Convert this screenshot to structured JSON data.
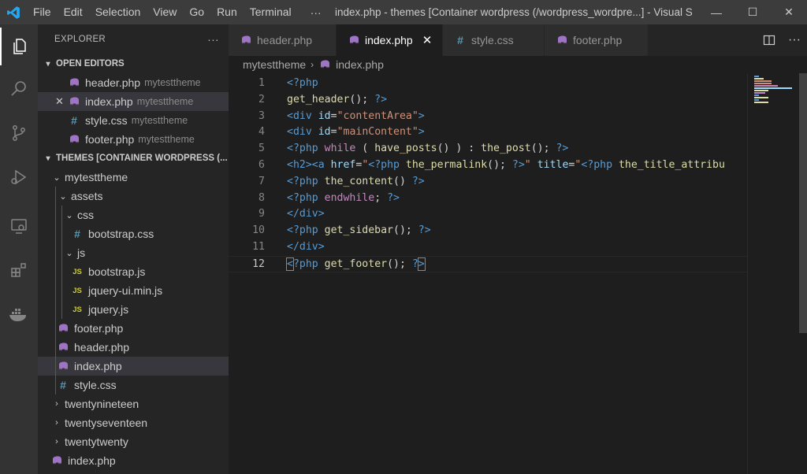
{
  "titlebar": {
    "menu": [
      "File",
      "Edit",
      "Selection",
      "View",
      "Go",
      "Run",
      "Terminal"
    ],
    "more": "···",
    "window_title": "index.php - themes [Container wordpress (/wordpress_wordpre...] - Visual S...",
    "minimize": "—",
    "maximize": "☐",
    "close": "✕"
  },
  "sidebar": {
    "title": "EXPLORER",
    "more": "···",
    "open_editors_title": "OPEN EDITORS",
    "open_editors": [
      {
        "name": "header.php",
        "folder": "mytesttheme",
        "type": "php"
      },
      {
        "name": "index.php",
        "folder": "mytesttheme",
        "type": "php"
      },
      {
        "name": "style.css",
        "folder": "mytesttheme",
        "type": "css"
      },
      {
        "name": "footer.php",
        "folder": "mytesttheme",
        "type": "php"
      }
    ],
    "workspace_title": "THEMES [CONTAINER WORDPRESS (...",
    "tree": {
      "mytesttheme": "mytesttheme",
      "assets": "assets",
      "css": "css",
      "bootstrap_css": "bootstrap.css",
      "js": "js",
      "bootstrap_js": "bootstrap.js",
      "jquery_ui": "jquery-ui.min.js",
      "jquery": "jquery.js",
      "footer_php": "footer.php",
      "header_php": "header.php",
      "index_php": "index.php",
      "style_css": "style.css",
      "twentynineteen": "twentynineteen",
      "twentyseventeen": "twentyseventeen",
      "twentytwenty": "twentytwenty",
      "root_index": "index.php"
    },
    "js_badge": "JS",
    "hash": "#",
    "close_x": "✕"
  },
  "tabs": [
    {
      "label": "header.php",
      "type": "php"
    },
    {
      "label": "index.php",
      "type": "php",
      "active": true
    },
    {
      "label": "style.css",
      "type": "css"
    },
    {
      "label": "footer.php",
      "type": "php"
    }
  ],
  "tab_close": "✕",
  "tab_more": "···",
  "breadcrumb": {
    "folder": "mytesttheme",
    "sep": "›",
    "file": "index.php"
  },
  "editor": {
    "line_numbers": [
      "1",
      "2",
      "3",
      "4",
      "5",
      "6",
      "7",
      "8",
      "9",
      "10",
      "11",
      "12"
    ],
    "lines": [
      [
        [
          "tag",
          "<?php"
        ]
      ],
      [
        [
          "fn",
          "get_header"
        ],
        [
          "plain",
          "(); "
        ],
        [
          "tag",
          "?>"
        ]
      ],
      [
        [
          "tag",
          "<div"
        ],
        [
          "plain",
          " "
        ],
        [
          "attr",
          "id"
        ],
        [
          "plain",
          "="
        ],
        [
          "str",
          "\"contentArea\""
        ],
        [
          "tag",
          ">"
        ]
      ],
      [
        [
          "tag",
          "<div"
        ],
        [
          "plain",
          " "
        ],
        [
          "attr",
          "id"
        ],
        [
          "plain",
          "="
        ],
        [
          "str",
          "\"mainContent\""
        ],
        [
          "tag",
          ">"
        ]
      ],
      [
        [
          "tag",
          "<?php"
        ],
        [
          "plain",
          " "
        ],
        [
          "kw",
          "while"
        ],
        [
          "plain",
          " ( "
        ],
        [
          "fn",
          "have_posts"
        ],
        [
          "plain",
          "() ) : "
        ],
        [
          "fn",
          "the_post"
        ],
        [
          "plain",
          "(); "
        ],
        [
          "tag",
          "?>"
        ]
      ],
      [
        [
          "tag",
          "<h2><a"
        ],
        [
          "plain",
          " "
        ],
        [
          "attr",
          "href"
        ],
        [
          "plain",
          "="
        ],
        [
          "str",
          "\""
        ],
        [
          "tag",
          "<?php"
        ],
        [
          "plain",
          " "
        ],
        [
          "fn",
          "the_permalink"
        ],
        [
          "plain",
          "(); "
        ],
        [
          "tag",
          "?>"
        ],
        [
          "str",
          "\""
        ],
        [
          "plain",
          " "
        ],
        [
          "attr",
          "title"
        ],
        [
          "plain",
          "="
        ],
        [
          "str",
          "\""
        ],
        [
          "tag",
          "<?php"
        ],
        [
          "plain",
          " "
        ],
        [
          "fn",
          "the_title_attribu"
        ]
      ],
      [
        [
          "tag",
          "<?php"
        ],
        [
          "plain",
          " "
        ],
        [
          "fn",
          "the_content"
        ],
        [
          "plain",
          "() "
        ],
        [
          "tag",
          "?>"
        ]
      ],
      [
        [
          "tag",
          "<?php"
        ],
        [
          "plain",
          " "
        ],
        [
          "kw",
          "endwhile"
        ],
        [
          "plain",
          "; "
        ],
        [
          "tag",
          "?>"
        ]
      ],
      [
        [
          "tag",
          "</div>"
        ]
      ],
      [
        [
          "tag",
          "<?php"
        ],
        [
          "plain",
          " "
        ],
        [
          "fn",
          "get_sidebar"
        ],
        [
          "plain",
          "(); "
        ],
        [
          "tag",
          "?>"
        ]
      ],
      [
        [
          "tag",
          "</div>"
        ]
      ],
      [
        [
          "tag",
          "<"
        ],
        [
          "tag",
          "?php"
        ],
        [
          "plain",
          " "
        ],
        [
          "fn",
          "get_footer"
        ],
        [
          "plain",
          "(); "
        ],
        [
          "tag",
          "?"
        ],
        [
          "tag",
          ">"
        ]
      ]
    ]
  },
  "colors": {
    "php_icon": "#a074c4",
    "css_icon": "#519aba",
    "js_icon": "#cbcb41",
    "accent": "#007acc"
  }
}
